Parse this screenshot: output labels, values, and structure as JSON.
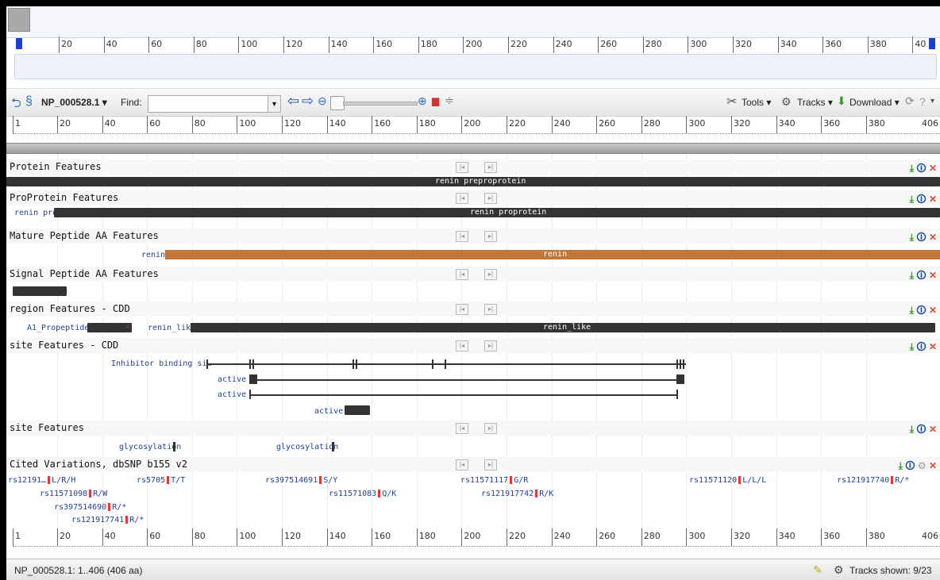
{
  "overview_ruler": {
    "labels": [
      "20",
      "40",
      "60",
      "80",
      "100",
      "120",
      "140",
      "160",
      "180",
      "200",
      "220",
      "240",
      "260",
      "280",
      "300",
      "320",
      "340",
      "360",
      "380",
      "40"
    ]
  },
  "toolbar": {
    "accession": "NP_000528.1",
    "find_label": "Find:",
    "find_value": "",
    "tools_label": "Tools",
    "tracks_label": "Tracks",
    "download_label": "Download"
  },
  "ruler": {
    "start_label": "1",
    "labels": [
      "20",
      "40",
      "60",
      "80",
      "100",
      "120",
      "140",
      "160",
      "180",
      "200",
      "220",
      "240",
      "260",
      "280",
      "300",
      "320",
      "340",
      "360",
      "380"
    ],
    "end_label": "406"
  },
  "tracks": {
    "protein": {
      "title": "Protein Features",
      "bar_label": "renin preproprotein"
    },
    "proprotein": {
      "title": "ProProtein Features",
      "left_label": "renin propr…",
      "bar_label": "renin proprotein"
    },
    "mature": {
      "title": "Mature Peptide AA Features",
      "left_label": "renin",
      "bar_label": "renin"
    },
    "signal": {
      "title": "Signal Peptide AA Features"
    },
    "region": {
      "title": "region Features - CDD",
      "label1": "A1_Propeptide",
      "label2": "renin_like",
      "bar_label": "renin_like"
    },
    "site_cdd": {
      "title": "site Features - CDD",
      "inhibitor_label": "Inhibitor binding si…",
      "active1": "active",
      "active2": "active",
      "active3": "active"
    },
    "site": {
      "title": "site Features",
      "glyco1": "glycosylation",
      "glyco2": "glycosylation"
    },
    "variations": {
      "title": "Cited Variations, dbSNP b155 v2",
      "items": [
        {
          "id": "rs12191…",
          "alleles": "L/R/H"
        },
        {
          "id": "rs5705",
          "alleles": "T/T"
        },
        {
          "id": "rs397514691",
          "alleles": "S/Y"
        },
        {
          "id": "rs11571117",
          "alleles": "G/R"
        },
        {
          "id": "rs11571120",
          "alleles": "L/L/L"
        },
        {
          "id": "rs121917740",
          "alleles": "R/*"
        },
        {
          "id": "rs11571098",
          "alleles": "R/W"
        },
        {
          "id": "rs11571083",
          "alleles": "Q/K"
        },
        {
          "id": "rs121917742",
          "alleles": "R/K"
        },
        {
          "id": "rs397514690",
          "alleles": "R/*"
        },
        {
          "id": "rs121917741",
          "alleles": "R/*"
        }
      ]
    }
  },
  "status": {
    "range_text": "NP_000528.1: 1..406 (406 aa)",
    "tracks_shown": "Tracks shown: 9/23"
  },
  "colors": {
    "accent": "#1a3fd1",
    "orange_bar": "#c1773a",
    "dark_bar": "#333333",
    "variant_marker": "#e33333"
  }
}
